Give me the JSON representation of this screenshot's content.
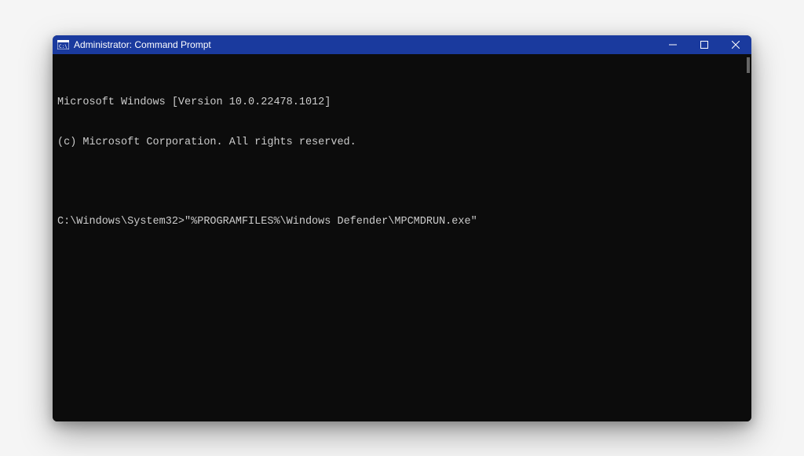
{
  "window": {
    "title": "Administrator: Command Prompt"
  },
  "terminal": {
    "header_line1": "Microsoft Windows [Version 10.0.22478.1012]",
    "header_line2": "(c) Microsoft Corporation. All rights reserved.",
    "prompt": "C:\\Windows\\System32>",
    "command": "\"%PROGRAMFILES%\\Windows Defender\\MPCMDRUN.exe\""
  }
}
